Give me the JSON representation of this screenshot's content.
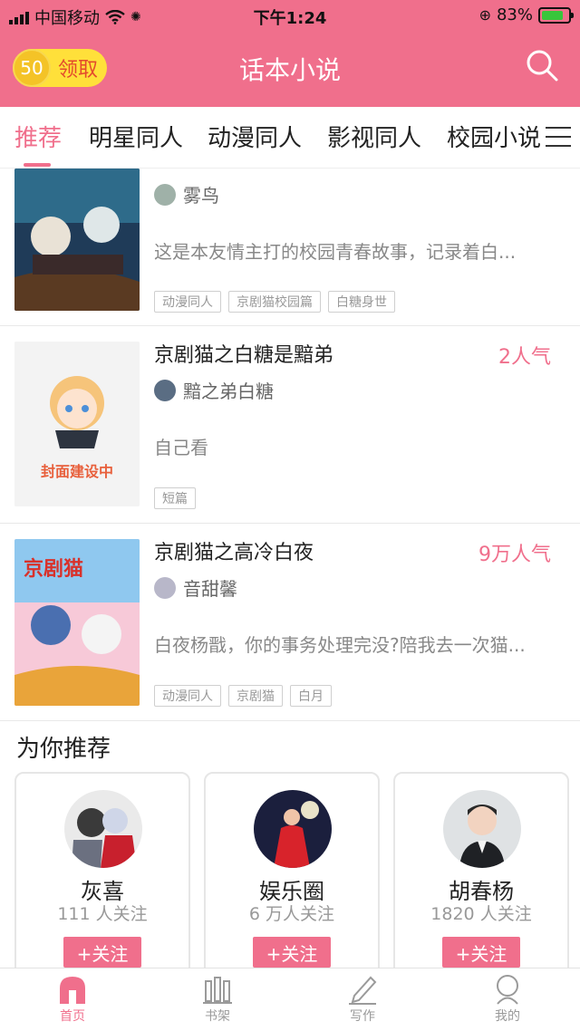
{
  "status_bar": {
    "carrier": "中国移动",
    "time": "下午1:24",
    "battery": "83%"
  },
  "header": {
    "coin_value": "50",
    "claim_label": "领取",
    "title": "话本小说"
  },
  "tabs": [
    {
      "label": "推荐",
      "active": true
    },
    {
      "label": "明星同人"
    },
    {
      "label": "动漫同人"
    },
    {
      "label": "影视同人"
    },
    {
      "label": "校园小说"
    }
  ],
  "books": [
    {
      "title": "",
      "popularity": "",
      "author": "雾鸟",
      "desc": "这是本友情主打的校园青春故事，记录着白...",
      "tags": [
        "动漫同人",
        "京剧猫校园篇",
        "白糖身世"
      ]
    },
    {
      "title": "京剧猫之白糖是黯弟",
      "popularity": "2人气",
      "author": "黯之弟白糖",
      "desc": "自己看",
      "tags": [
        "短篇"
      ],
      "cover_text": "封面建设中"
    },
    {
      "title": "京剧猫之高冷白夜",
      "popularity": "9万人气",
      "author": "音甜馨",
      "desc": "白夜杨戬，你的事务处理完没?陪我去一次猫...",
      "tags": [
        "动漫同人",
        "京剧猫",
        "白月"
      ]
    }
  ],
  "recommend": {
    "title": "为你推荐",
    "follow_label": "+关注",
    "cards": [
      {
        "name": "灰喜",
        "fans": "111 人关注"
      },
      {
        "name": "娱乐圈",
        "fans": "6 万人关注"
      },
      {
        "name": "胡春杨",
        "fans": "1820 人关注"
      }
    ]
  },
  "bottom_nav": [
    {
      "label": "首页",
      "icon": "home-icon",
      "active": true
    },
    {
      "label": "书架",
      "icon": "bookshelf-icon"
    },
    {
      "label": "写作",
      "icon": "pen-icon"
    },
    {
      "label": "我的",
      "icon": "profile-icon"
    }
  ],
  "colors": {
    "brand": "#f06f8c",
    "coin": "#ffe03a"
  }
}
